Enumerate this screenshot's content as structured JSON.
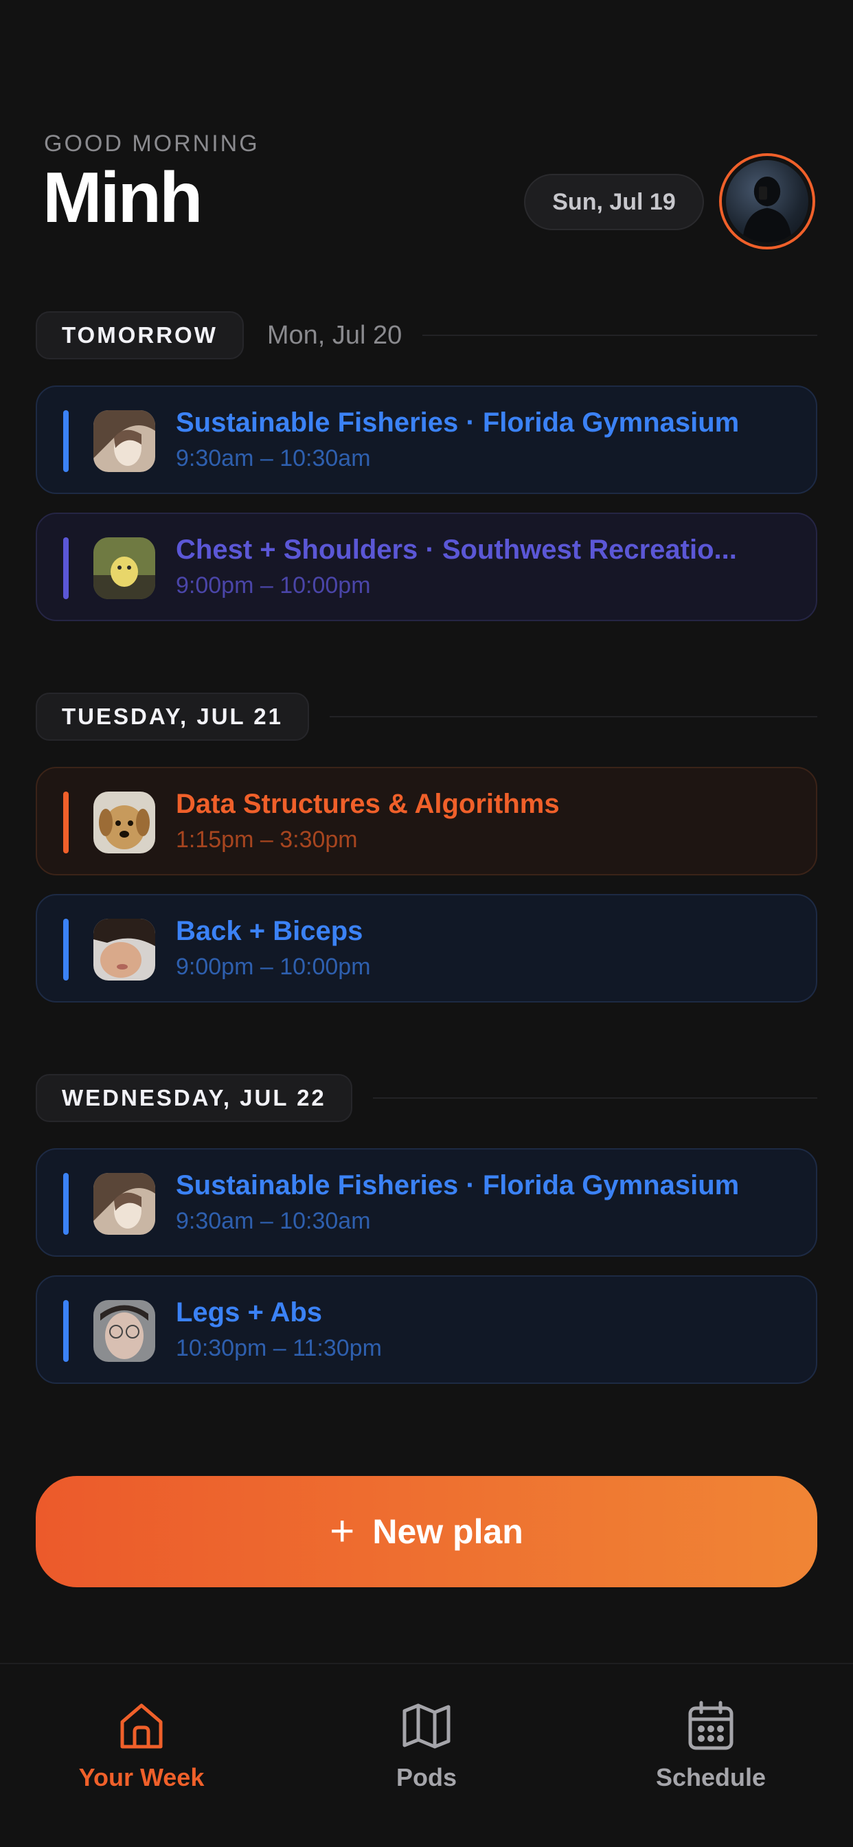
{
  "header": {
    "greeting": "GOOD MORNING",
    "name": "Minh",
    "today": "Sun, Jul 19"
  },
  "days": [
    {
      "label": "TOMORROW",
      "sub": "Mon, Jul 20",
      "events": [
        {
          "title": "Sustainable Fisheries · Florida Gymnasium",
          "time": "9:30am – 10:30am",
          "color": "blue"
        },
        {
          "title": "Chest + Shoulders · Southwest Recreatio...",
          "time": "9:00pm – 10:00pm",
          "color": "purple"
        }
      ]
    },
    {
      "label": "TUESDAY, JUL 21",
      "events": [
        {
          "title": "Data Structures & Algorithms",
          "time": "1:15pm – 3:30pm",
          "color": "orange"
        },
        {
          "title": "Back + Biceps",
          "time": "9:00pm – 10:00pm",
          "color": "blue"
        }
      ]
    },
    {
      "label": "WEDNESDAY, JUL 22",
      "events": [
        {
          "title": "Sustainable Fisheries · Florida Gymnasium",
          "time": "9:30am – 10:30am",
          "color": "blue"
        },
        {
          "title": "Legs + Abs",
          "time": "10:30pm – 11:30pm",
          "color": "blue"
        }
      ]
    }
  ],
  "new_plan": {
    "icon": "plus-icon",
    "label": "New plan"
  },
  "tabs": [
    {
      "label": "Your Week",
      "icon": "home-icon",
      "active": true
    },
    {
      "label": "Pods",
      "icon": "map-icon",
      "active": false
    },
    {
      "label": "Schedule",
      "icon": "calendar-icon",
      "active": false
    }
  ],
  "colors": {
    "accent": "#f0602a",
    "blue": "#3b82f6",
    "purple": "#5b57d6",
    "background": "#121212"
  }
}
